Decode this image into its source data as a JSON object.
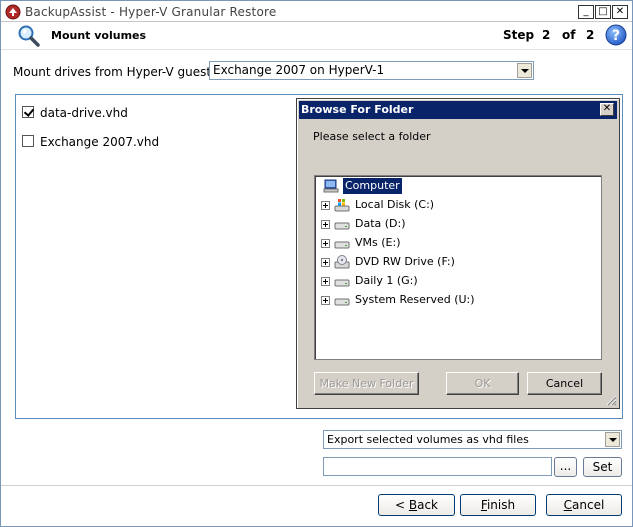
{
  "window": {
    "title": "BackupAssist - Hyper-V Granular Restore",
    "min_glyph": "_",
    "max_glyph": "□",
    "close_glyph": "✕"
  },
  "header": {
    "title": "Mount volumes",
    "step_word": "Step",
    "step_current": "2",
    "step_of": "of",
    "step_total": "2",
    "help_glyph": "?"
  },
  "mount": {
    "label": "Mount drives from Hyper-V guest:",
    "selected_guest": "Exchange 2007 on HyperV-1"
  },
  "volumes": [
    {
      "label": "data-drive.vhd",
      "checked": true
    },
    {
      "label": "Exchange 2007.vhd",
      "checked": false
    }
  ],
  "dialog": {
    "title": "Browse For Folder",
    "close_glyph": "✕",
    "prompt": "Please select a folder",
    "tree": {
      "root": "Computer",
      "children": [
        {
          "label": "Local Disk (C:)",
          "icon": "local-disk-icon"
        },
        {
          "label": "Data (D:)",
          "icon": "drive-icon"
        },
        {
          "label": "VMs (E:)",
          "icon": "drive-icon"
        },
        {
          "label": "DVD RW Drive (F:)",
          "icon": "dvd-drive-icon"
        },
        {
          "label": "Daily 1 (G:)",
          "icon": "drive-icon"
        },
        {
          "label": "System Reserved (U:)",
          "icon": "drive-icon"
        }
      ]
    },
    "make_new_folder": "Make New Folder",
    "ok": "OK",
    "cancel": "Cancel"
  },
  "export": {
    "mode": "Export selected volumes as vhd files",
    "path_value": "",
    "browse_label": "...",
    "set_label": "Set"
  },
  "footer": {
    "back_prefix": "< ",
    "back_key": "B",
    "back_rest": "ack",
    "finish_key": "F",
    "finish_rest": "inish",
    "cancel_key": "C",
    "cancel_rest": "ancel"
  },
  "colors": {
    "selection": "#0a246a",
    "panel_border": "#5a8dbb",
    "dialog_face": "#d4d0c8"
  }
}
